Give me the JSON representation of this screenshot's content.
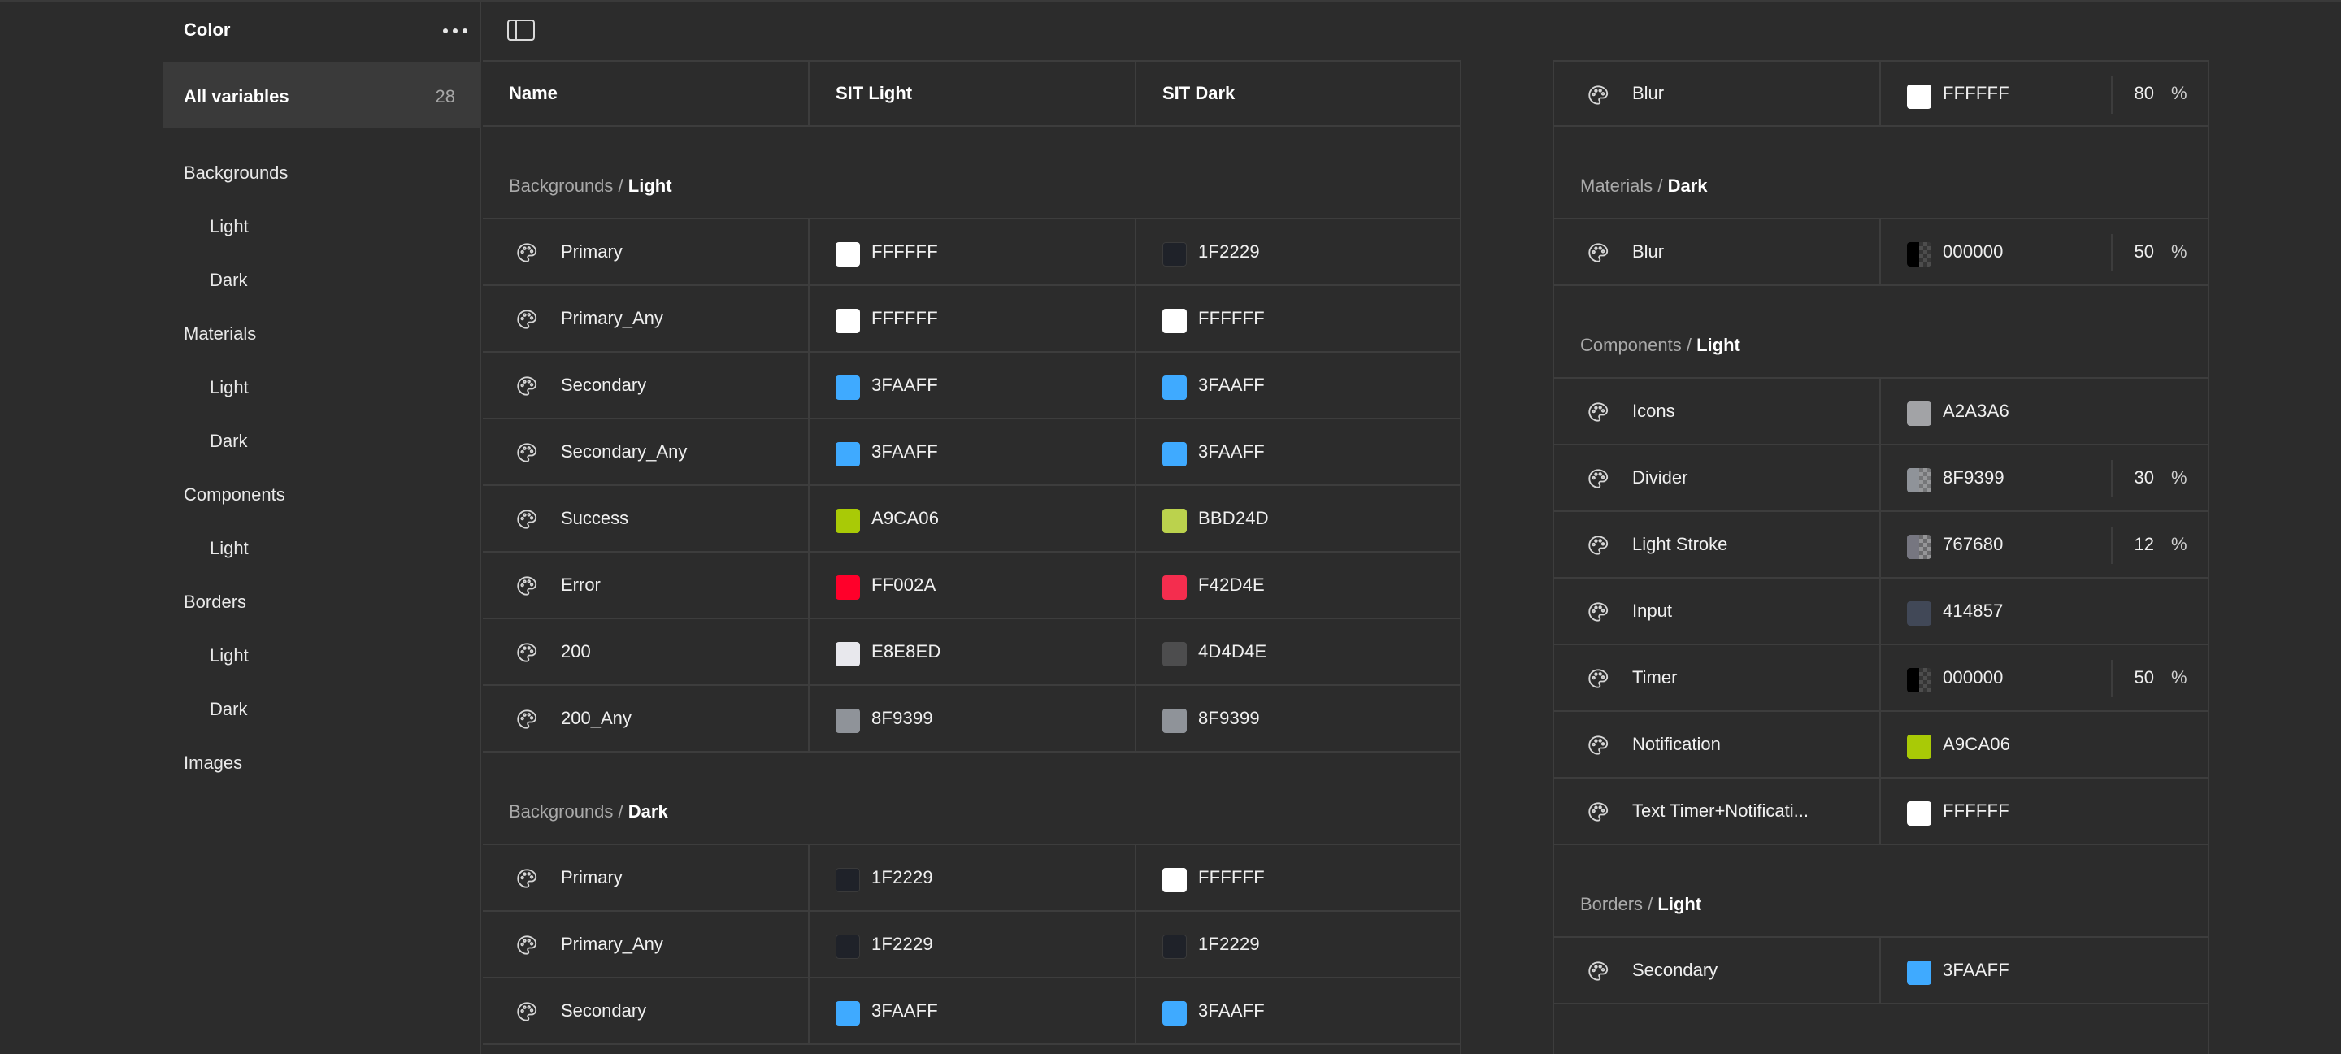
{
  "sidebar": {
    "title": "Color",
    "all_label": "All variables",
    "all_count": "28",
    "items": [
      {
        "label": "Backgrounds",
        "level": 0
      },
      {
        "label": "Light",
        "level": 1
      },
      {
        "label": "Dark",
        "level": 1
      },
      {
        "label": "Materials",
        "level": 0
      },
      {
        "label": "Light",
        "level": 1
      },
      {
        "label": "Dark",
        "level": 1
      },
      {
        "label": "Components",
        "level": 0
      },
      {
        "label": "Light",
        "level": 1
      },
      {
        "label": "Borders",
        "level": 0
      },
      {
        "label": "Light",
        "level": 1
      },
      {
        "label": "Dark",
        "level": 1
      },
      {
        "label": "Images",
        "level": 0
      }
    ]
  },
  "columns": {
    "name": "Name",
    "mode1": "SIT Light",
    "mode2": "SIT Dark"
  },
  "left_sections": [
    {
      "group": "Backgrounds",
      "sep": " / ",
      "sub": "Light",
      "rows": [
        {
          "name": "Primary",
          "v1": {
            "hex": "FFFFFF",
            "color": "#FFFFFF"
          },
          "v2": {
            "hex": "1F2229",
            "color": "#1F2229"
          }
        },
        {
          "name": "Primary_Any",
          "v1": {
            "hex": "FFFFFF",
            "color": "#FFFFFF"
          },
          "v2": {
            "hex": "FFFFFF",
            "color": "#FFFFFF"
          }
        },
        {
          "name": "Secondary",
          "v1": {
            "hex": "3FAAFF",
            "color": "#3FAAFF"
          },
          "v2": {
            "hex": "3FAAFF",
            "color": "#3FAAFF"
          }
        },
        {
          "name": "Secondary_Any",
          "v1": {
            "hex": "3FAAFF",
            "color": "#3FAAFF"
          },
          "v2": {
            "hex": "3FAAFF",
            "color": "#3FAAFF"
          }
        },
        {
          "name": "Success",
          "v1": {
            "hex": "A9CA06",
            "color": "#A9CA06"
          },
          "v2": {
            "hex": "BBD24D",
            "color": "#BBD24D"
          }
        },
        {
          "name": "Error",
          "v1": {
            "hex": "FF002A",
            "color": "#FF002A"
          },
          "v2": {
            "hex": "F42D4E",
            "color": "#F42D4E"
          }
        },
        {
          "name": "200",
          "v1": {
            "hex": "E8E8ED",
            "color": "#E8E8ED"
          },
          "v2": {
            "hex": "4D4D4E",
            "color": "#4D4D4E"
          }
        },
        {
          "name": "200_Any",
          "v1": {
            "hex": "8F9399",
            "color": "#8F9399"
          },
          "v2": {
            "hex": "8F9399",
            "color": "#8F9399"
          }
        }
      ]
    },
    {
      "group": "Backgrounds",
      "sep": " / ",
      "sub": "Dark",
      "rows": [
        {
          "name": "Primary",
          "v1": {
            "hex": "1F2229",
            "color": "#1F2229"
          },
          "v2": {
            "hex": "FFFFFF",
            "color": "#FFFFFF"
          }
        },
        {
          "name": "Primary_Any",
          "v1": {
            "hex": "1F2229",
            "color": "#1F2229"
          },
          "v2": {
            "hex": "1F2229",
            "color": "#1F2229"
          }
        },
        {
          "name": "Secondary",
          "v1": {
            "hex": "3FAAFF",
            "color": "#3FAAFF"
          },
          "v2": {
            "hex": "3FAAFF",
            "color": "#3FAAFF"
          }
        }
      ]
    }
  ],
  "right_top_row": {
    "name": "Blur",
    "hex": "FFFFFF",
    "color": "#FFFFFF",
    "opacity": "80",
    "pct": "%"
  },
  "right_sections": [
    {
      "group": "Materials",
      "sep": " / ",
      "sub": "Dark",
      "rows": [
        {
          "name": "Blur",
          "hex": "000000",
          "color": "#000000",
          "opacity": "50",
          "pct": "%",
          "alpha": 0.5
        }
      ]
    },
    {
      "group": "Components",
      "sep": " / ",
      "sub": "Light",
      "rows": [
        {
          "name": "Icons",
          "hex": "A2A3A6",
          "color": "#A2A3A6"
        },
        {
          "name": "Divider",
          "hex": "8F9399",
          "color": "#8F9399",
          "opacity": "30",
          "pct": "%",
          "alpha": 0.3
        },
        {
          "name": "Light Stroke",
          "hex": "767680",
          "color": "#767680",
          "opacity": "12",
          "pct": "%",
          "alpha": 0.12
        },
        {
          "name": "Input",
          "hex": "414857",
          "color": "#414857"
        },
        {
          "name": "Timer",
          "hex": "000000",
          "color": "#000000",
          "opacity": "50",
          "pct": "%",
          "alpha": 0.5
        },
        {
          "name": "Notification",
          "hex": "A9CA06",
          "color": "#A9CA06"
        },
        {
          "name": "Text  Timer+Notificati...",
          "hex": "FFFFFF",
          "color": "#FFFFFF"
        }
      ]
    },
    {
      "group": "Borders",
      "sep": " / ",
      "sub": "Light",
      "rows": [
        {
          "name": "Secondary",
          "hex": "3FAAFF",
          "color": "#3FAAFF"
        }
      ]
    }
  ],
  "icons": {
    "more": "more-horizontal-icon",
    "panel": "sidebar-toggle-icon",
    "variable": "palette-icon"
  },
  "colors": {
    "background": "#2c2c2c",
    "selected": "#3a3a3a",
    "border": "#3d3d3d"
  }
}
